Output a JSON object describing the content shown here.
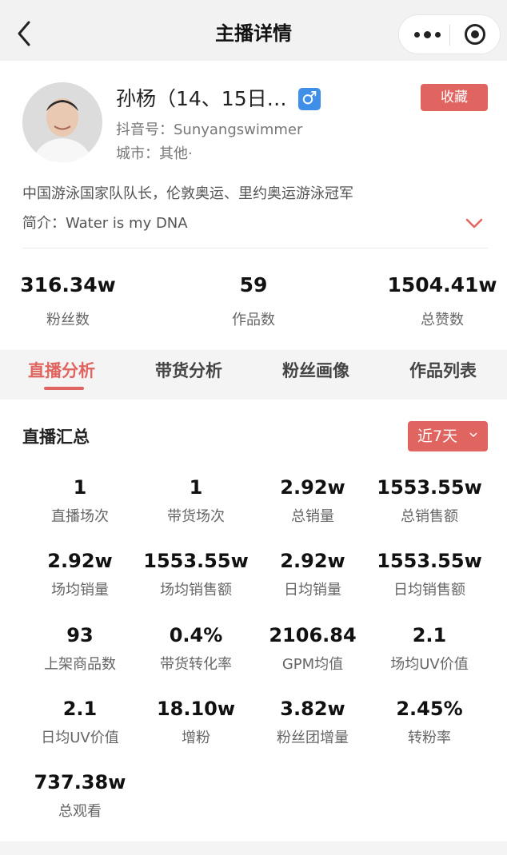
{
  "nav": {
    "title": "主播详情"
  },
  "profile": {
    "name": "孙杨（14、15日…",
    "gender_symbol": "♂",
    "favorite_label": "收藏",
    "douyin_id": "抖音号：Sunyangswimmer",
    "city": "城市：其他·",
    "description": "中国游泳国家队队长，伦敦奥运、里约奥运游泳冠军",
    "intro": "简介：Water is my DNA",
    "stats": [
      {
        "value": "316.34w",
        "label": "粉丝数"
      },
      {
        "value": "59",
        "label": "作品数"
      },
      {
        "value": "1504.41w",
        "label": "总赞数"
      }
    ]
  },
  "tabs": [
    {
      "label": "直播分析"
    },
    {
      "label": "带货分析"
    },
    {
      "label": "粉丝画像"
    },
    {
      "label": "作品列表"
    }
  ],
  "summary": {
    "title": "直播汇总",
    "range_label": "近7天",
    "metrics": [
      {
        "value": "1",
        "label": "直播场次"
      },
      {
        "value": "1",
        "label": "带货场次"
      },
      {
        "value": "2.92w",
        "label": "总销量"
      },
      {
        "value": "1553.55w",
        "label": "总销售额"
      },
      {
        "value": "2.92w",
        "label": "场均销量"
      },
      {
        "value": "1553.55w",
        "label": "场均销售额"
      },
      {
        "value": "2.92w",
        "label": "日均销量"
      },
      {
        "value": "1553.55w",
        "label": "日均销售额"
      },
      {
        "value": "93",
        "label": "上架商品数"
      },
      {
        "value": "0.4%",
        "label": "带货转化率"
      },
      {
        "value": "2106.84",
        "label": "GPM均值"
      },
      {
        "value": "2.1",
        "label": "场均UV价值"
      },
      {
        "value": "2.1",
        "label": "日均UV价值"
      },
      {
        "value": "18.10w",
        "label": "增粉"
      },
      {
        "value": "3.82w",
        "label": "粉丝团增量"
      },
      {
        "value": "2.45%",
        "label": "转粉率"
      },
      {
        "value": "737.38w",
        "label": "总观看"
      }
    ]
  },
  "colors": {
    "accent": "#e0645f",
    "gender_badge": "#3f8ee8"
  }
}
